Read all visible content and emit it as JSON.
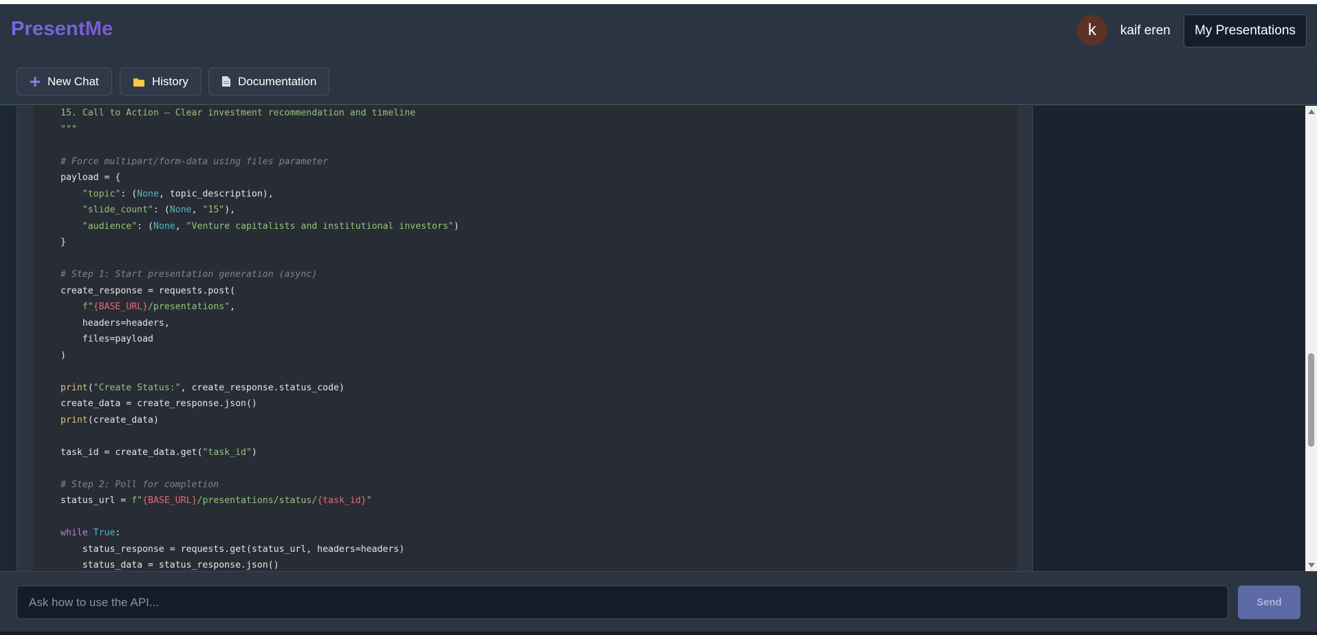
{
  "navbar": {
    "brand": "PresentMe",
    "avatar_initial": "k",
    "username": "kaif eren",
    "my_presentations_label": "My Presentations"
  },
  "toolbar": {
    "new_chat_label": "New Chat",
    "history_label": "History",
    "documentation_label": "Documentation"
  },
  "code": {
    "lines": [
      "15. Call to Action – Clear investment recommendation and timeline",
      "\"\"\"",
      "",
      "# Force multipart/form-data using files parameter",
      "payload = {",
      "    \"topic\": (None, topic_description),",
      "    \"slide_count\": (None, \"15\"),",
      "    \"audience\": (None, \"Venture capitalists and institutional investors\")",
      "}",
      "",
      "# Step 1: Start presentation generation (async)",
      "create_response = requests.post(",
      "    f\"{BASE_URL}/presentations\",",
      "    headers=headers,",
      "    files=payload",
      ")",
      "",
      "print(\"Create Status:\", create_response.status_code)",
      "create_data = create_response.json()",
      "print(create_data)",
      "",
      "task_id = create_data.get(\"task_id\")",
      "",
      "# Step 2: Poll for completion",
      "status_url = f\"{BASE_URL}/presentations/status/{task_id}\"",
      "",
      "while True:",
      "    status_response = requests.get(status_url, headers=headers)",
      "    status_data = status_response.json()"
    ]
  },
  "chat": {
    "placeholder": "Ask how to use the API...",
    "send_label": "Send"
  },
  "colors": {
    "accent": "#6d6fe0",
    "send_button": "#5c6aa5",
    "code_string": "#98c379",
    "code_keyword": "#c678dd",
    "code_builtin": "#e5c07b",
    "code_constant": "#56b6c2",
    "code_interpolation": "#e06c75",
    "code_comment": "#7f848e"
  },
  "icons": {
    "new_chat": "plus-icon",
    "history": "folder-icon",
    "documentation": "document-icon"
  }
}
